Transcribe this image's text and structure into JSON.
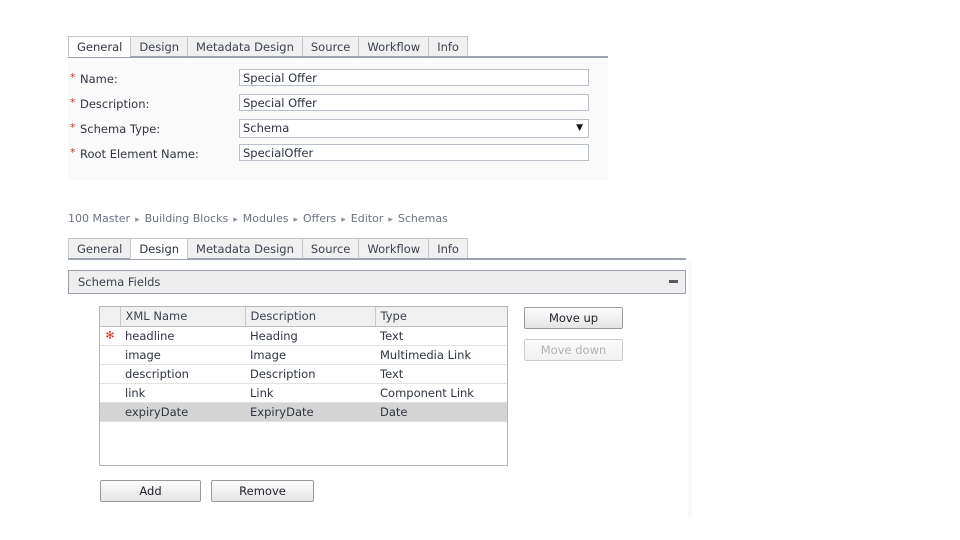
{
  "top_form": {
    "tabs": [
      {
        "label": "General",
        "active": true
      },
      {
        "label": "Design",
        "active": false
      },
      {
        "label": "Metadata Design",
        "active": false
      },
      {
        "label": "Source",
        "active": false
      },
      {
        "label": "Workflow",
        "active": false
      },
      {
        "label": "Info",
        "active": false
      }
    ],
    "fields": [
      {
        "label": "Name:",
        "required": "*",
        "value": "Special Offer",
        "type": "text"
      },
      {
        "label": "Description:",
        "required": "*",
        "value": "Special Offer",
        "type": "text"
      },
      {
        "label": "Schema Type:",
        "required": "*",
        "value": "Schema",
        "type": "select"
      },
      {
        "label": "Root Element Name:",
        "required": "*",
        "value": "SpecialOffer",
        "type": "text"
      }
    ],
    "select_arrow": "▼"
  },
  "breadcrumb": {
    "separator": "▸",
    "items": [
      "100 Master",
      "Building Blocks",
      "Modules",
      "Offers",
      "Editor",
      "Schemas"
    ]
  },
  "lower": {
    "tabs": [
      {
        "label": "General",
        "active": false
      },
      {
        "label": "Design",
        "active": true
      },
      {
        "label": "Metadata Design",
        "active": false
      },
      {
        "label": "Source",
        "active": false
      },
      {
        "label": "Workflow",
        "active": false
      },
      {
        "label": "Info",
        "active": false
      }
    ],
    "panel_title": "Schema Fields",
    "collapse_icon": "minus-icon",
    "table": {
      "columns": [
        "",
        "XML Name",
        "Description",
        "Type"
      ],
      "rows": [
        {
          "flag": "✻",
          "name": "headline",
          "description": "Heading",
          "type": "Text",
          "selected": false
        },
        {
          "flag": "",
          "name": "image",
          "description": "Image",
          "type": "Multimedia Link",
          "selected": false
        },
        {
          "flag": "",
          "name": "description",
          "description": "Description",
          "type": "Text",
          "selected": false
        },
        {
          "flag": "",
          "name": "link",
          "description": "Link",
          "type": "Component Link",
          "selected": false
        },
        {
          "flag": "",
          "name": "expiryDate",
          "description": "ExpiryDate",
          "type": "Date",
          "selected": true
        }
      ]
    },
    "buttons": {
      "move_up": "Move up",
      "move_down": "Move down",
      "move_down_disabled": true,
      "add": "Add",
      "remove": "Remove"
    }
  },
  "colors": {
    "required_star": "#cc3322",
    "tab_border": "#9aa2ad",
    "selected_row": "#d4d4d4",
    "panel_header_bg": "#eeeeee"
  }
}
